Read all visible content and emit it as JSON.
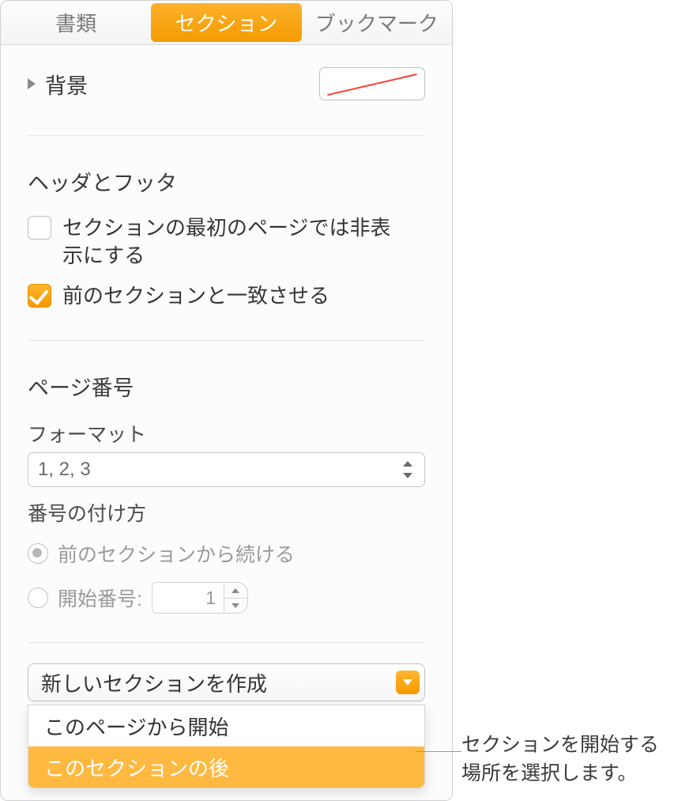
{
  "tabs": {
    "doc": "書類",
    "section": "セクション",
    "bookmark": "ブックマーク"
  },
  "background": {
    "label": "背景"
  },
  "headerFooter": {
    "title": "ヘッダとフッタ",
    "hideFirst": "セクションの最初のページでは非表示にする",
    "matchPrev": "前のセクションと一致させる"
  },
  "pageNumber": {
    "title": "ページ番号",
    "formatLabel": "フォーマット",
    "formatValue": "1, 2, 3",
    "methodLabel": "番号の付け方",
    "continue": "前のセクションから続ける",
    "startAt": "開始番号:",
    "startValue": "1"
  },
  "newSection": {
    "button": "新しいセクションを作成",
    "opt1": "このページから開始",
    "opt2": "このセクションの後"
  },
  "callout": "セクションを開始する場所を選択します。"
}
